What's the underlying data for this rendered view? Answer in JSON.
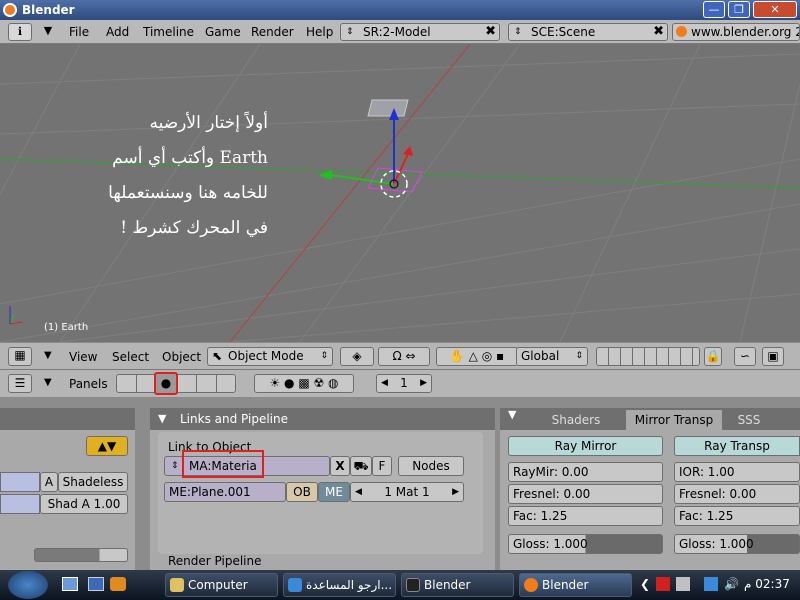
{
  "window": {
    "title": "Blender",
    "minimize": "—",
    "restore": "❐",
    "close": "✕"
  },
  "menubar": {
    "items": [
      "File",
      "Add",
      "Timeline",
      "Game",
      "Render",
      "Help"
    ],
    "screen_field": "SR:2-Model",
    "scene_field": "SCE:Scene",
    "website": "www.blender.org 2"
  },
  "viewport": {
    "overlay_lines": [
      "أولاً إختار الأرضيه",
      "Earth وأكتب أي أسم",
      "للخامه هنا وسنستعملها",
      "في المحرك كشرط !"
    ],
    "object_label": "(1) Earth"
  },
  "view_header": {
    "menus": [
      "View",
      "Select",
      "Object"
    ],
    "mode": "Object Mode",
    "orientation": "Global"
  },
  "buttons_header": {
    "panels_label": "Panels",
    "frame": "1"
  },
  "left_panel": {
    "buttons": [
      "A",
      "Shadeless",
      "Shad A 1.00"
    ]
  },
  "links_panel": {
    "title": "Links and Pipeline",
    "link_label": "Link to Object",
    "material_field": "MA:Materia",
    "x_btn": "X",
    "f_btn": "F",
    "nodes_btn": "Nodes",
    "mesh_field": "ME:Plane.001",
    "ob_btn": "OB",
    "me_btn": "ME",
    "mat_counter": "1 Mat 1",
    "render_pipeline": "Render Pipeline"
  },
  "right_panel": {
    "tabs": [
      "Shaders",
      "Mirror Transp",
      "SSS"
    ],
    "ray_mirror": "Ray Mirror",
    "ray_transp": "Ray Transp",
    "raymir": "RayMir: 0.00",
    "ior": "IOR: 1.00",
    "fresnel_left": "Fresnel: 0.00",
    "fresnel_right": "Fresnel: 0.00",
    "fac_left": "Fac: 1.25",
    "fac_right": "Fac: 1.25",
    "gloss_left": "Gloss: 1.000",
    "gloss_right": "Gloss: 1.000"
  },
  "taskbar": {
    "tasks": [
      "Computer",
      "ارجو المساعدة...",
      "Blender",
      "Blender"
    ],
    "clock": "02:37 م"
  },
  "colors": {
    "highlight_box": "#e02020",
    "viewport_bg": "#737373",
    "panel_bg": "#a9a9a9",
    "tab_active": "#b9d8d8"
  }
}
